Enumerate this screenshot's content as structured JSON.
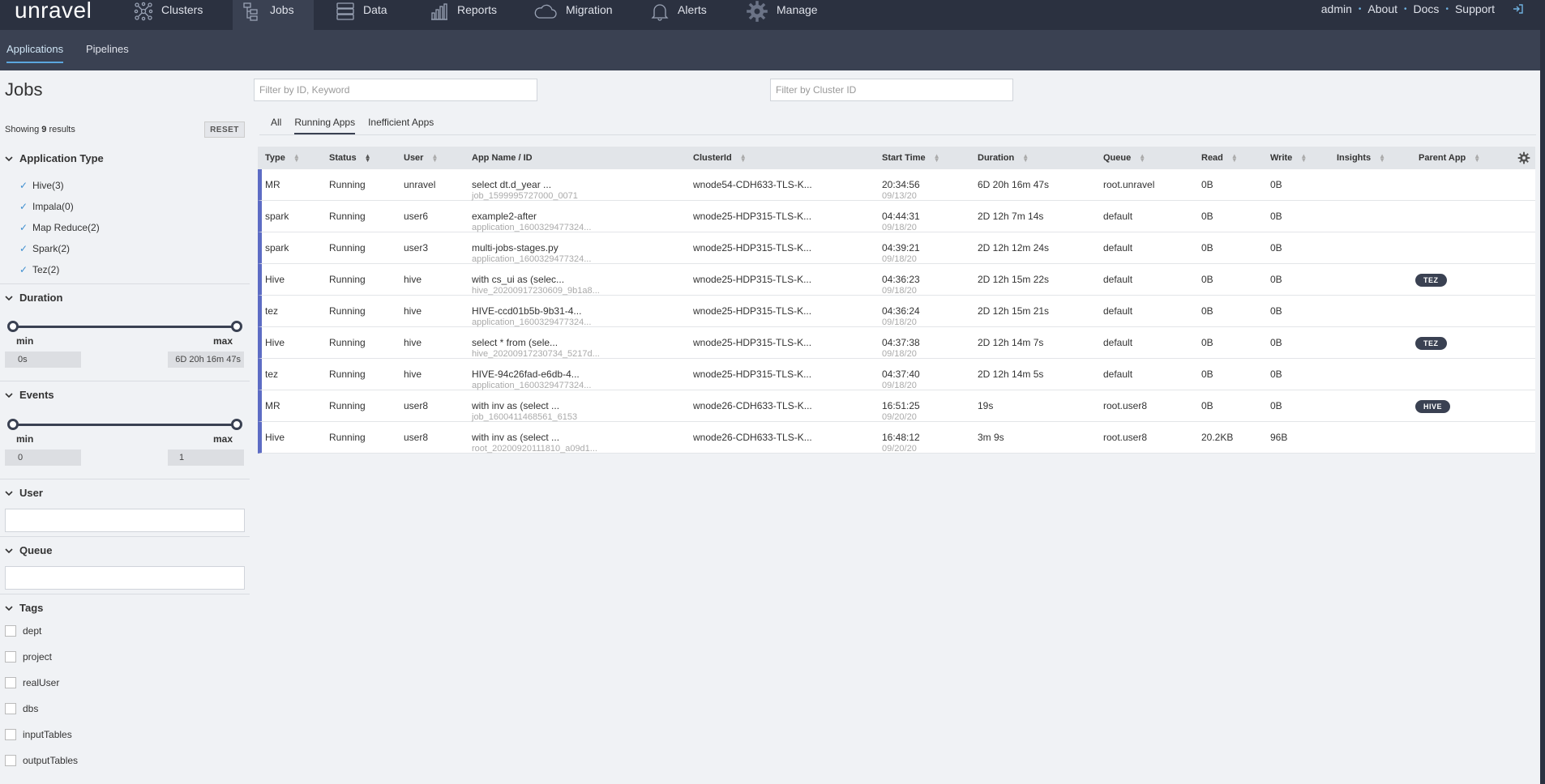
{
  "nav": {
    "logo": "unravel",
    "items": [
      {
        "label": "Clusters",
        "icon": "clusters-icon"
      },
      {
        "label": "Jobs",
        "icon": "jobs-icon",
        "active": true
      },
      {
        "label": "Data",
        "icon": "data-icon"
      },
      {
        "label": "Reports",
        "icon": "reports-icon"
      },
      {
        "label": "Migration",
        "icon": "cloud-icon"
      },
      {
        "label": "Alerts",
        "icon": "bell-icon"
      },
      {
        "label": "Manage",
        "icon": "gear-icon"
      }
    ],
    "right": [
      "admin",
      "About",
      "Docs",
      "Support"
    ]
  },
  "subnav": {
    "tabs": [
      "Applications",
      "Pipelines"
    ]
  },
  "page": {
    "title": "Jobs",
    "filter_id_placeholder": "Filter by ID, Keyword",
    "filter_cluster_placeholder": "Filter by Cluster ID"
  },
  "sidebar": {
    "showing_prefix": "Showing",
    "showing_count": "9",
    "showing_suffix": "results",
    "reset": "RESET",
    "app_type_title": "Application Type",
    "app_types": [
      "Hive(3)",
      "Impala(0)",
      "Map Reduce(2)",
      "Spark(2)",
      "Tez(2)"
    ],
    "duration_title": "Duration",
    "duration_min_label": "min",
    "duration_max_label": "max",
    "duration_min": "0s",
    "duration_max": "6D 20h 16m 47s",
    "events_title": "Events",
    "events_min_label": "min",
    "events_max_label": "max",
    "events_min": "0",
    "events_max": "1",
    "user_title": "User",
    "queue_title": "Queue",
    "tags_title": "Tags",
    "tags": [
      "dept",
      "project",
      "realUser",
      "dbs",
      "inputTables",
      "outputTables"
    ]
  },
  "tabs": [
    "All",
    "Running Apps",
    "Inefficient Apps"
  ],
  "table": {
    "columns": [
      "Type",
      "Status",
      "User",
      "App Name / ID",
      "ClusterId",
      "Start Time",
      "Duration",
      "Queue",
      "Read",
      "Write",
      "Insights",
      "Parent App"
    ],
    "rows": [
      {
        "type": "MR",
        "status": "Running",
        "user": "unravel",
        "app_name": "select dt.d_year ...",
        "app_id": "job_1599995727000_0071",
        "cluster": "wnode54-CDH633-TLS-K...",
        "start_time": "20:34:56",
        "start_date": "09/13/20",
        "duration": "6D 20h 16m 47s",
        "queue": "root.unravel",
        "read": "0B",
        "write": "0B",
        "parent": ""
      },
      {
        "type": "spark",
        "status": "Running",
        "user": "user6",
        "app_name": "example2-after",
        "app_id": "application_1600329477324...",
        "cluster": "wnode25-HDP315-TLS-K...",
        "start_time": "04:44:31",
        "start_date": "09/18/20",
        "duration": "2D 12h 7m 14s",
        "queue": "default",
        "read": "0B",
        "write": "0B",
        "parent": ""
      },
      {
        "type": "spark",
        "status": "Running",
        "user": "user3",
        "app_name": "multi-jobs-stages.py",
        "app_id": "application_1600329477324...",
        "cluster": "wnode25-HDP315-TLS-K...",
        "start_time": "04:39:21",
        "start_date": "09/18/20",
        "duration": "2D 12h 12m 24s",
        "queue": "default",
        "read": "0B",
        "write": "0B",
        "parent": ""
      },
      {
        "type": "Hive",
        "status": "Running",
        "user": "hive",
        "app_name": "with cs_ui as (selec...",
        "app_id": "hive_20200917230609_9b1a8...",
        "cluster": "wnode25-HDP315-TLS-K...",
        "start_time": "04:36:23",
        "start_date": "09/18/20",
        "duration": "2D 12h 15m 22s",
        "queue": "default",
        "read": "0B",
        "write": "0B",
        "parent": "TEZ"
      },
      {
        "type": "tez",
        "status": "Running",
        "user": "hive",
        "app_name": "HIVE-ccd01b5b-9b31-4...",
        "app_id": "application_1600329477324...",
        "cluster": "wnode25-HDP315-TLS-K...",
        "start_time": "04:36:24",
        "start_date": "09/18/20",
        "duration": "2D 12h 15m 21s",
        "queue": "default",
        "read": "0B",
        "write": "0B",
        "parent": ""
      },
      {
        "type": "Hive",
        "status": "Running",
        "user": "hive",
        "app_name": "select * from (sele...",
        "app_id": "hive_20200917230734_5217d...",
        "cluster": "wnode25-HDP315-TLS-K...",
        "start_time": "04:37:38",
        "start_date": "09/18/20",
        "duration": "2D 12h 14m 7s",
        "queue": "default",
        "read": "0B",
        "write": "0B",
        "parent": "TEZ"
      },
      {
        "type": "tez",
        "status": "Running",
        "user": "hive",
        "app_name": "HIVE-94c26fad-e6db-4...",
        "app_id": "application_1600329477324...",
        "cluster": "wnode25-HDP315-TLS-K...",
        "start_time": "04:37:40",
        "start_date": "09/18/20",
        "duration": "2D 12h 14m 5s",
        "queue": "default",
        "read": "0B",
        "write": "0B",
        "parent": ""
      },
      {
        "type": "MR",
        "status": "Running",
        "user": "user8",
        "app_name": "with inv as (select ...",
        "app_id": "job_1600411468561_6153",
        "cluster": "wnode26-CDH633-TLS-K...",
        "start_time": "16:51:25",
        "start_date": "09/20/20",
        "duration": "19s",
        "queue": "root.user8",
        "read": "0B",
        "write": "0B",
        "parent": "HIVE"
      },
      {
        "type": "Hive",
        "status": "Running",
        "user": "user8",
        "app_name": "with inv as (select ...",
        "app_id": "root_20200920111810_a09d1...",
        "cluster": "wnode26-CDH633-TLS-K...",
        "start_time": "16:48:12",
        "start_date": "09/20/20",
        "duration": "3m 9s",
        "queue": "root.user8",
        "read": "20.2KB",
        "write": "96B",
        "parent": ""
      }
    ]
  }
}
